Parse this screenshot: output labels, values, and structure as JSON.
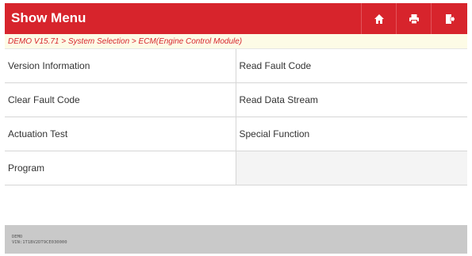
{
  "header": {
    "title": "Show Menu",
    "icons": [
      "home-icon",
      "print-icon",
      "exit-icon"
    ],
    "accent_color": "#d7242c"
  },
  "breadcrumb": "DEMO V15.71 > System Selection > ECM(Engine Control Module)",
  "menu": {
    "rows": [
      [
        "Version Information",
        "Read Fault Code"
      ],
      [
        "Clear Fault Code",
        "Read Data Stream"
      ],
      [
        "Actuation Test",
        "Special Function"
      ],
      [
        "Program",
        ""
      ]
    ]
  },
  "footer": {
    "line1": "DEMO",
    "line2": "VIN:1T1BV2DT9CE030000"
  }
}
